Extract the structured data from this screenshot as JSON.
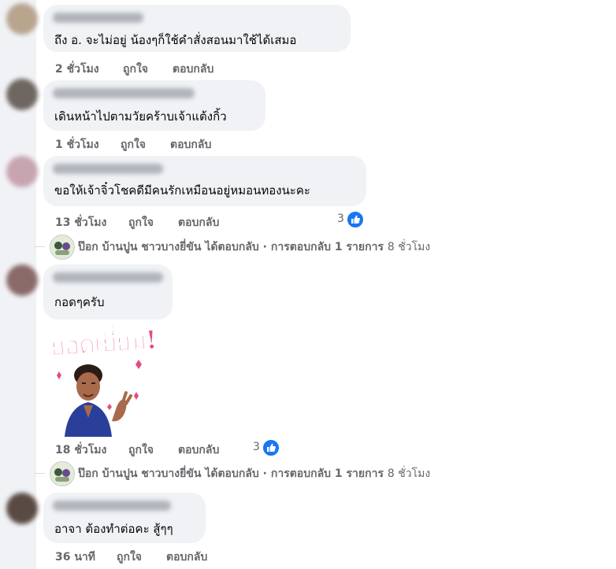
{
  "comments": [
    {
      "text": "ถึง อ. จะไม่อยู่ น้องๆก็ใช้คำสั่งสอนมาใช้ได้เสมอ",
      "time": "2 ชั่วโมง",
      "like": "ถูกใจ",
      "reply": "ตอบกลับ"
    },
    {
      "text": "เดินหน้าไปตามวัยคร้าบเจ้าแต้งกิ้ว",
      "time": "1 ชั่วโมง",
      "like": "ถูกใจ",
      "reply": "ตอบกลับ"
    },
    {
      "text": "ขอให้เจ้าจิ๋วโชคดีมีคนรักเหมือนอยู่หมอนทองนะคะ",
      "time": "13 ชั่วโมง",
      "like": "ถูกใจ",
      "reply": "ตอบกลับ",
      "reactions": "3",
      "reply_summary": {
        "text": "ป๊อก บ้านปูน ชาวบางยี่ขัน ได้ตอบกลับ · การตอบกลับ 1 รายการ",
        "time": "8 ชั่วโมง"
      }
    },
    {
      "text": "กอดๆครับ",
      "sticker_text": "ยอดเยี่ยม!",
      "time": "18 ชั่วโมง",
      "like": "ถูกใจ",
      "reply": "ตอบกลับ",
      "reactions": "3",
      "reply_summary": {
        "text": "ป๊อก บ้านปูน ชาวบางยี่ขัน ได้ตอบกลับ · การตอบกลับ 1 รายการ",
        "time": "8 ชั่วโมง"
      }
    },
    {
      "text": "อาจา ต้องทำต่อคะ สู้ๆๆ",
      "time": "36 นาที",
      "like": "ถูกใจ",
      "reply": "ตอบกลับ"
    }
  ],
  "colors": {
    "bubble": "#f0f2f5",
    "meta_text": "#65676b",
    "like_blue": "#1877f2",
    "sticker_pink": "#e84a7a"
  }
}
